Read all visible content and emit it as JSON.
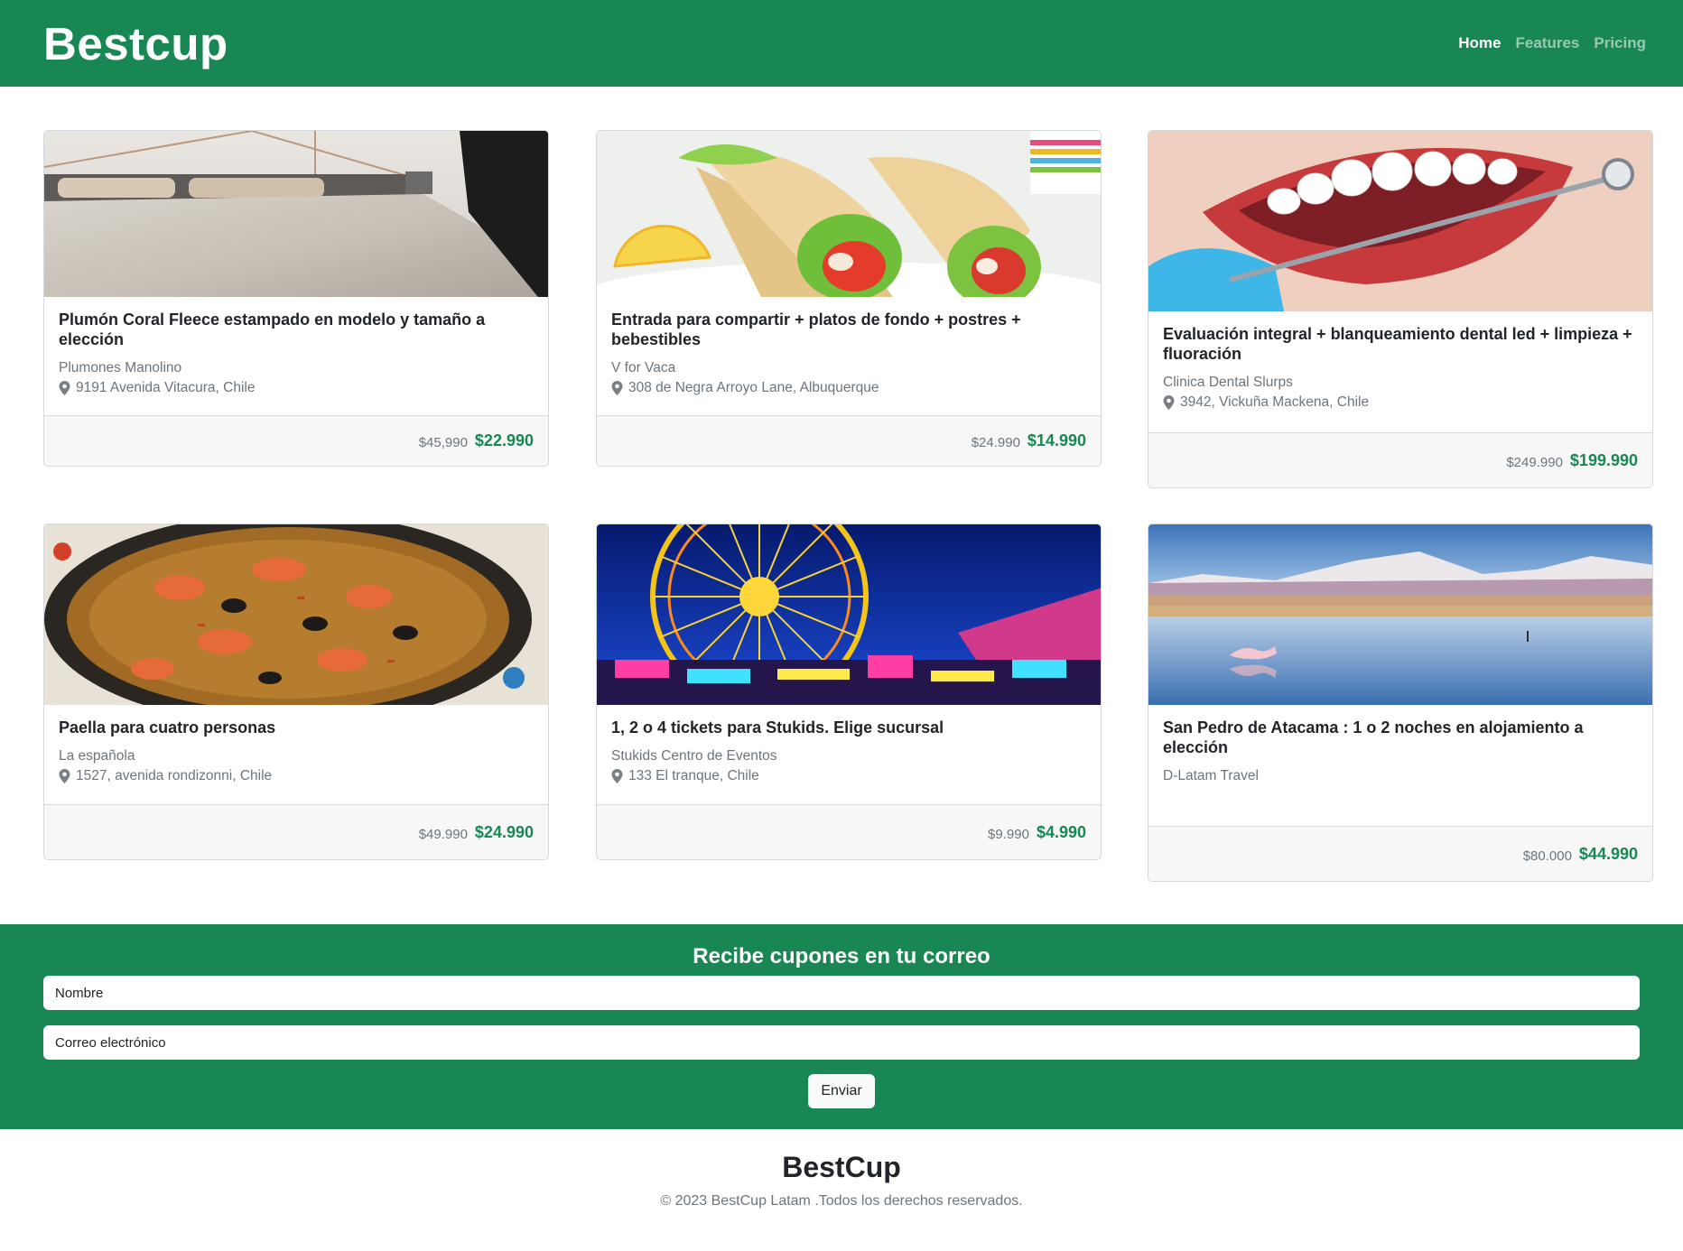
{
  "header": {
    "brand": "Bestcup",
    "nav": [
      {
        "label": "Home",
        "active": true
      },
      {
        "label": "Features",
        "active": false
      },
      {
        "label": "Pricing",
        "active": false
      }
    ]
  },
  "cards": [
    {
      "title": "Plumón Coral Fleece estampado en modelo y tamaño a elección",
      "merchant": "Plumones Manolino",
      "location": "9191 Avenida Vitacura, Chile",
      "old_price": "$45,990",
      "price": "$22.990"
    },
    {
      "title": "Entrada para compartir + platos de fondo + postres + bebestibles",
      "merchant": "V for Vaca",
      "location": "308 de Negra Arroyo Lane, Albuquerque",
      "old_price": "$24.990",
      "price": "$14.990"
    },
    {
      "title": "Evaluación integral + blanqueamiento dental led + limpieza + fluoración",
      "merchant": "Clinica Dental Slurps",
      "location": "3942, Vickuña Mackena, Chile",
      "old_price": "$249.990",
      "price": "$199.990"
    },
    {
      "title": "Paella para cuatro personas",
      "merchant": "La española",
      "location": "1527, avenida rondizonni, Chile",
      "old_price": "$49.990",
      "price": "$24.990"
    },
    {
      "title": "1, 2 o 4 tickets para Stukids. Elige sucursal",
      "merchant": "Stukids Centro de Eventos",
      "location": "133 El tranque, Chile",
      "old_price": "$9.990",
      "price": "$4.990"
    },
    {
      "title": "San Pedro de Atacama : 1 o 2 noches en alojamiento a elección",
      "merchant": "D-Latam Travel",
      "location": "",
      "old_price": "$80.000",
      "price": "$44.990"
    }
  ],
  "icons": {
    "location": "map-pin-icon"
  },
  "newsletter": {
    "title": "Recibe cupones en tu correo",
    "name_placeholder": "Nombre",
    "email_placeholder": "Correo electrónico",
    "submit_label": "Enviar"
  },
  "footer": {
    "brand": "BestCup",
    "copyright": "© 2023 BestCup Latam .Todos los derechos reservados."
  },
  "colors": {
    "primary": "#198754",
    "muted": "#6c757d",
    "card_footer_bg": "#f7f7f7"
  }
}
